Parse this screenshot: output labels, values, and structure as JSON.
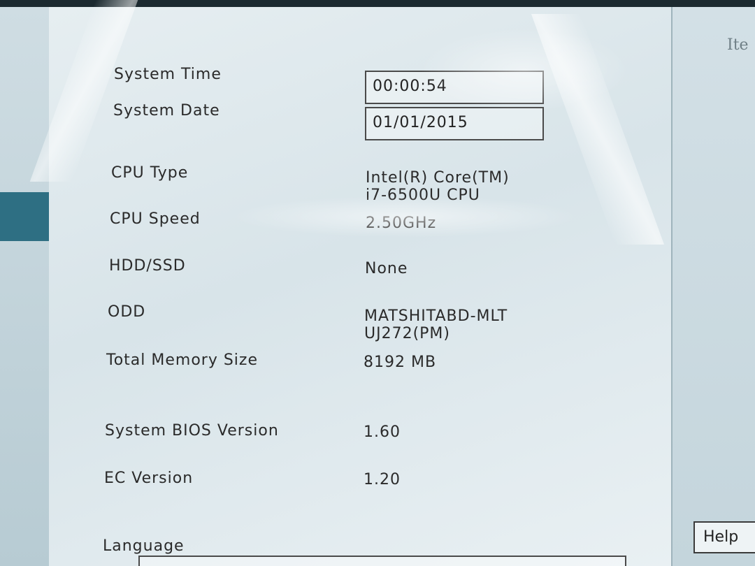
{
  "right_panel": {
    "header": "Ite",
    "help_label": "Help"
  },
  "system_info": {
    "time_label": "System Time",
    "time_value": "00:00:54",
    "date_label": "System Date",
    "date_value": "01/01/2015",
    "cpu_type_label": "CPU Type",
    "cpu_type_line1": "Intel(R) Core(TM)",
    "cpu_type_line2": "i7-6500U CPU",
    "cpu_speed_label": "CPU Speed",
    "cpu_speed_value": "2.50GHz",
    "hdd_label": "HDD/SSD",
    "hdd_value": "None",
    "odd_label": "ODD",
    "odd_line1": "MATSHITABD-MLT",
    "odd_line2": "UJ272(PM)",
    "memory_label": "Total Memory Size",
    "memory_value": "8192 MB",
    "bios_label": "System BIOS Version",
    "bios_value": "1.60",
    "ec_label": "EC Version",
    "ec_value": "1.20",
    "language_label": "Language"
  },
  "colors": {
    "panel_background": "#e2ebef",
    "selected_nav": "#2e6f83",
    "text": "#2a2a2a"
  }
}
